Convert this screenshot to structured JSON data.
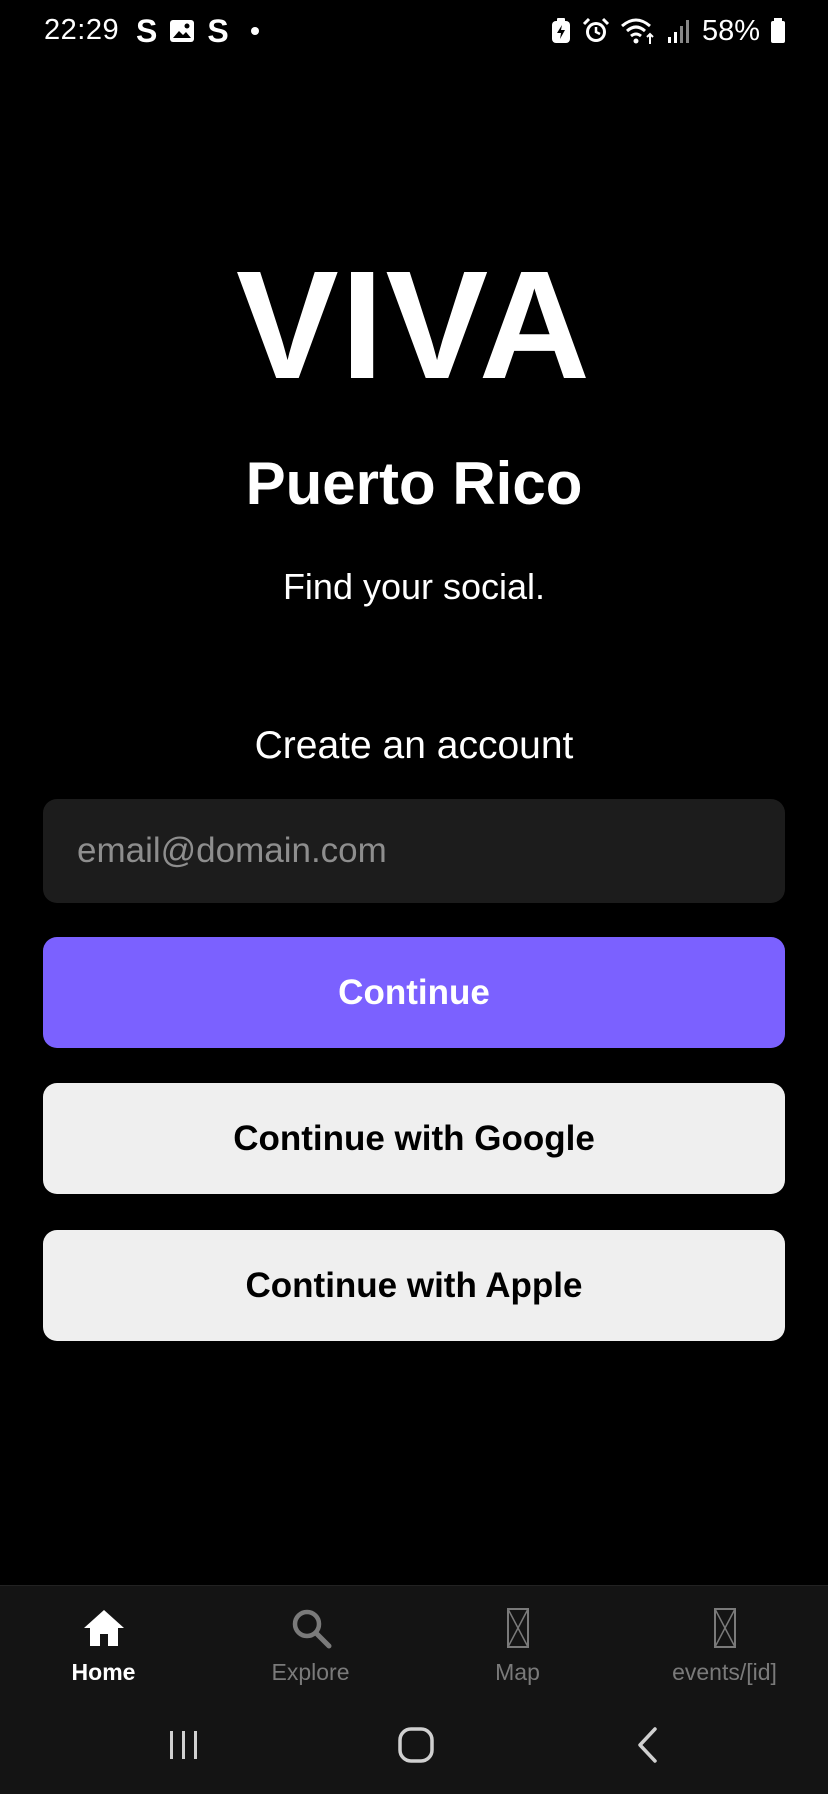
{
  "status_bar": {
    "time": "22:29",
    "left_icons": [
      "s-notification-icon",
      "gallery-icon",
      "s-notification-icon",
      "dot-icon"
    ],
    "s_glyph": "S",
    "right_icons": [
      "battery-saver-icon",
      "alarm-icon",
      "wifi-icon",
      "signal-icon",
      "battery-icon"
    ],
    "battery_level": "58%"
  },
  "hero": {
    "title": "VIVA",
    "subtitle": "Puerto Rico",
    "tagline": "Find your social."
  },
  "form": {
    "heading": "Create an account",
    "email_placeholder": "email@domain.com",
    "email_value": "",
    "continue_label": "Continue",
    "google_label": "Continue with Google",
    "apple_label": "Continue with Apple"
  },
  "tabs": [
    {
      "label": "Home",
      "icon": "home-icon",
      "active": true
    },
    {
      "label": "Explore",
      "icon": "search-icon",
      "active": false
    },
    {
      "label": "Map",
      "icon": "placeholder-icon",
      "active": false
    },
    {
      "label": "events/[id]",
      "icon": "placeholder-icon",
      "active": false
    }
  ],
  "nav_bar": {
    "buttons": [
      "recent-apps-icon",
      "home-circle-icon",
      "back-icon"
    ]
  },
  "colors": {
    "background": "#000000",
    "accent": "#7b61ff",
    "secondary_button": "#efefef",
    "input_background": "#1c1c1c",
    "tab_bar": "#141414",
    "tab_inactive": "#7a7a7a"
  }
}
